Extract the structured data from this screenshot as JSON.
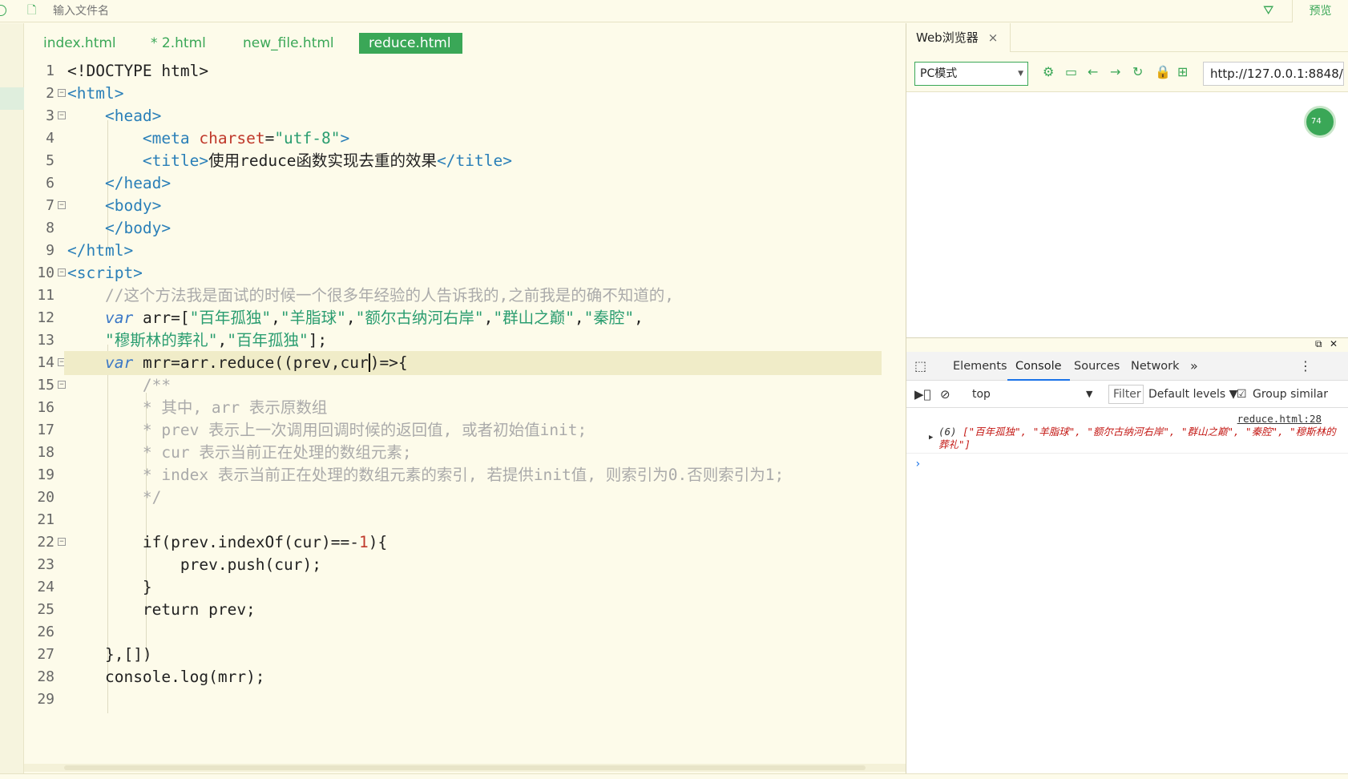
{
  "topbar": {
    "search_placeholder": "输入文件名",
    "preview_label": "预览"
  },
  "tabs": [
    {
      "label": "index.html"
    },
    {
      "label": "* 2.html"
    },
    {
      "label": "new_file.html"
    },
    {
      "label": "reduce.html",
      "active": true
    }
  ],
  "editor": {
    "line_numbers": [
      "1",
      "2",
      "3",
      "4",
      "5",
      "6",
      "7",
      "8",
      "9",
      "10",
      "11",
      "12",
      "13",
      "14",
      "15",
      "16",
      "17",
      "18",
      "19",
      "20",
      "21",
      "22",
      "23",
      "24",
      "25",
      "26",
      "27",
      "28",
      "29"
    ],
    "current_line": 14,
    "lines": {
      "l1": "<!DOCTYPE html>",
      "l2_tag": "<html>",
      "l3_tag": "<head>",
      "l4_open": "<meta ",
      "l4_attr": "charset",
      "l4_eq": "=",
      "l4_val": "\"utf-8\"",
      "l4_close": ">",
      "l5_open": "<title>",
      "l5_text": "使用reduce函数实现去重的效果",
      "l5_close": "</title>",
      "l6_tag": "</head>",
      "l7_tag": "<body>",
      "l8_tag": "</body>",
      "l9_tag": "</html>",
      "l10_tag": "<script>",
      "l11_comment": "//这个方法我是面试的时候一个很多年经验的人告诉我的,之前我是的确不知道的,",
      "l12_kw": "var",
      "l12_a": " arr=[",
      "l12_s1": "\"百年孤独\"",
      "l12_s2": "\"羊脂球\"",
      "l12_s3": "\"额尔古纳河右岸\"",
      "l12_s4": "\"群山之巅\"",
      "l12_s5": "\"秦腔\"",
      "l12_comma": ",",
      "l13_s1": "\"穆斯林的葬礼\"",
      "l13_s2": "\"百年孤独\"",
      "l13_end": "];",
      "l14_kw": "var",
      "l14_a": " mrr=arr.reduce((prev,cur",
      "l14_b": ")=>{",
      "l15": "/**",
      "l16": "* 其中, arr 表示原数组",
      "l17": "* prev 表示上一次调用回调时候的返回值, 或者初始值init;",
      "l18": "* cur 表示当前正在处理的数组元素;",
      "l19": "* index 表示当前正在处理的数组元素的索引, 若提供init值, 则索引为0.否则索引为1;",
      "l20": "*/",
      "l22_a": "if(prev.indexOf(cur)==-",
      "l22_num": "1",
      "l22_b": "){",
      "l23": "prev.push(cur);",
      "l24": "}",
      "l25": "return prev;",
      "l27": "},[])",
      "l28": "console.log(mrr);"
    }
  },
  "browser": {
    "tab_label": "Web浏览器",
    "tab_close": "×",
    "mode": "PC模式",
    "url": "http://127.0.0.1:8848/",
    "badge": "74"
  },
  "devtools": {
    "tabs": [
      "Elements",
      "Console",
      "Sources",
      "Network"
    ],
    "more": "»",
    "context": "top",
    "filter": "Filter",
    "levels": "Default levels ▼",
    "group": "Group similar",
    "log_source": "reduce.html:28",
    "log_count": "(6) ",
    "log_text": "[\"百年孤独\", \"羊脂球\", \"额尔古纳河右岸\", \"群山之巅\", \"秦腔\", \"穆斯林的葬礼\"]",
    "prompt": "›"
  }
}
